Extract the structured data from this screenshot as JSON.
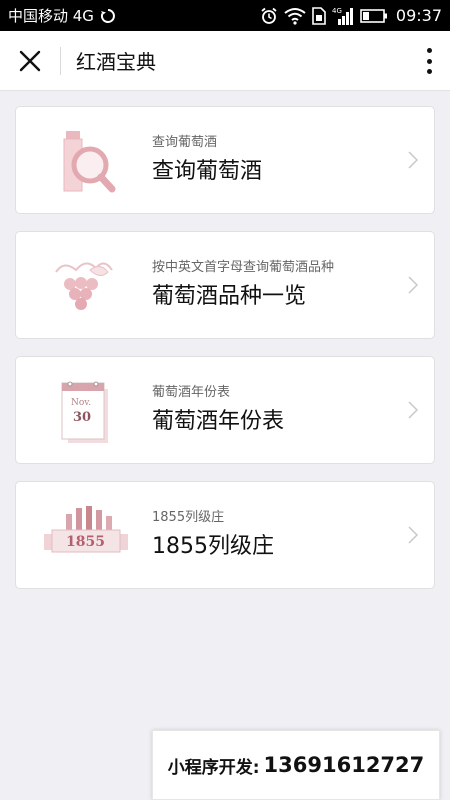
{
  "status_bar": {
    "carrier": "中国移动 4G",
    "network": "4G",
    "time": "09:37"
  },
  "nav": {
    "title": "红酒宝典"
  },
  "cards": [
    {
      "subtitle": "查询葡萄酒",
      "title": "查询葡萄酒",
      "icon": "wine-search-icon"
    },
    {
      "subtitle": "按中英文首字母查询葡萄酒品种",
      "title": "葡萄酒品种一览",
      "icon": "grape-icon"
    },
    {
      "subtitle": "葡萄酒年份表",
      "title": "葡萄酒年份表",
      "icon": "calendar-icon",
      "calendar_month": "Nov.",
      "calendar_day": "30"
    },
    {
      "subtitle": "1855列级庄",
      "title": "1855列级庄",
      "icon": "wine-bottles-icon",
      "banner_text": "1855"
    }
  ],
  "ad": {
    "label": "小程序开发:",
    "phone": "13691612727"
  },
  "colors": {
    "accent_pink": "#f0c4c8",
    "status_bar_bg": "#000000",
    "page_bg": "#efeff4"
  }
}
